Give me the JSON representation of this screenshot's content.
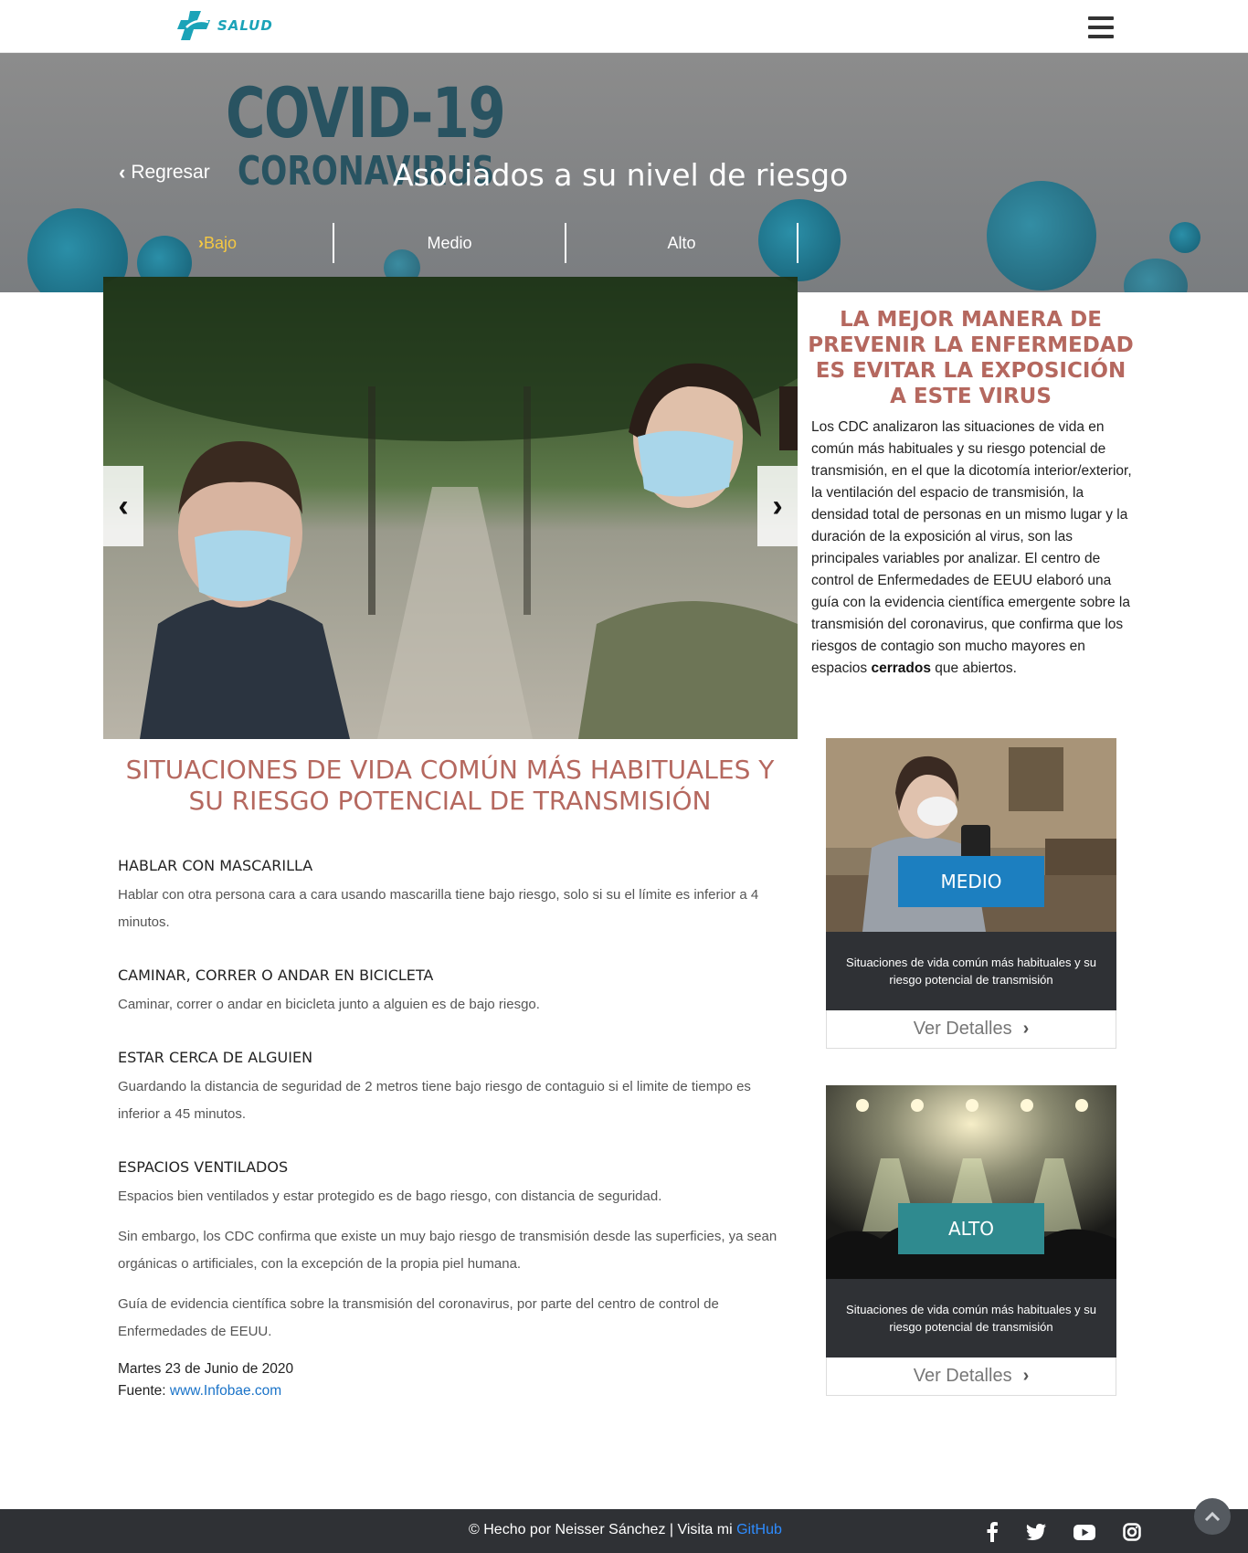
{
  "navbar": {
    "logo_text": "SALUD",
    "menu_icon": "hamburger-menu-icon"
  },
  "hero": {
    "banner_text_1": "COVID-19",
    "banner_text_2": "CORONAVIRUS",
    "back_label": "Regresar",
    "title": "Asociados a su nivel de riesgo",
    "tabs": [
      {
        "label": "Bajo",
        "active": true
      },
      {
        "label": "Medio",
        "active": false
      },
      {
        "label": "Alto",
        "active": false
      }
    ],
    "active_color": "#f5c842"
  },
  "carousel": {
    "prev_icon": "chevron-left-icon",
    "next_icon": "chevron-right-icon"
  },
  "article": {
    "title": "SITUACIONES DE VIDA COMÚN MÁS HABITUALES Y SU RIESGO POTENCIAL DE TRANSMISIÓN",
    "sections": [
      {
        "heading": "HABLAR CON MASCARILLA",
        "text": "Hablar con otra persona cara a cara usando mascarilla tiene bajo riesgo, solo si su el límite es inferior a 4 minutos."
      },
      {
        "heading": "CAMINAR, CORRER O ANDAR EN BICICLETA",
        "text": "Caminar, correr o andar en bicicleta junto a alguien es de bajo riesgo."
      },
      {
        "heading": "ESTAR CERCA DE ALGUIEN",
        "text": "Guardando la distancia de seguridad de 2 metros tiene bajo riesgo de contaguio si el limite de tiempo es inferior a 45 minutos."
      },
      {
        "heading": "ESPACIOS VENTILADOS",
        "text": "Espacios bien ventilados y estar protegido es de bago riesgo, con distancia de seguridad."
      }
    ],
    "para_1": "Sin embargo, los CDC confirma que existe un muy bajo riesgo de transmisión desde las superficies, ya sean orgánicas o artificiales, con la excepción de la propia piel humana.",
    "para_2": "Guía de evidencia científica sobre la transmisión del coronavirus, por parte del centro de control de Enfermedades de EEUU.",
    "date": "Martes 23 de Junio de 2020",
    "source_label": "Fuente: ",
    "source_link": "www.Infobae.com"
  },
  "aside": {
    "title": "LA MEJOR MANERA DE PREVENIR LA ENFERMEDAD ES EVITAR LA EXPOSICIÓN A ESTE VIRUS",
    "text_before_bold": "Los CDC analizaron las situaciones de vida en común más habituales y su riesgo potencial de transmisión, en el que la dicotomía interior/exterior, la ventilación del espacio de transmisión, la densidad total de personas en un mismo lugar y la duración de la exposición al virus, son las principales variables por analizar. El centro de control de Enfermedades de EEUU elaboró una guía con la evidencia científica emergente sobre la transmisión del coronavirus, que confirma que los riesgos de contagio son mucho mayores en espacios ",
    "bold_word": "cerrados",
    "text_after_bold": " que abiertos."
  },
  "cards": [
    {
      "badge": "MEDIO",
      "badge_color": "#1c7fc0",
      "desc": "Situaciones de vida común más habituales y su riesgo potencial de transmisión",
      "button": "Ver Detalles"
    },
    {
      "badge": "ALTO",
      "badge_color": "#2f8a8f",
      "desc": "Situaciones de vida común más habituales y su riesgo potencial de transmisión",
      "button": "Ver Detalles"
    }
  ],
  "footer": {
    "text": "© Hecho por Neisser Sánchez | Visita mi ",
    "github": "GitHub",
    "icons": [
      "facebook-icon",
      "twitter-icon",
      "youtube-icon",
      "instagram-icon"
    ]
  }
}
